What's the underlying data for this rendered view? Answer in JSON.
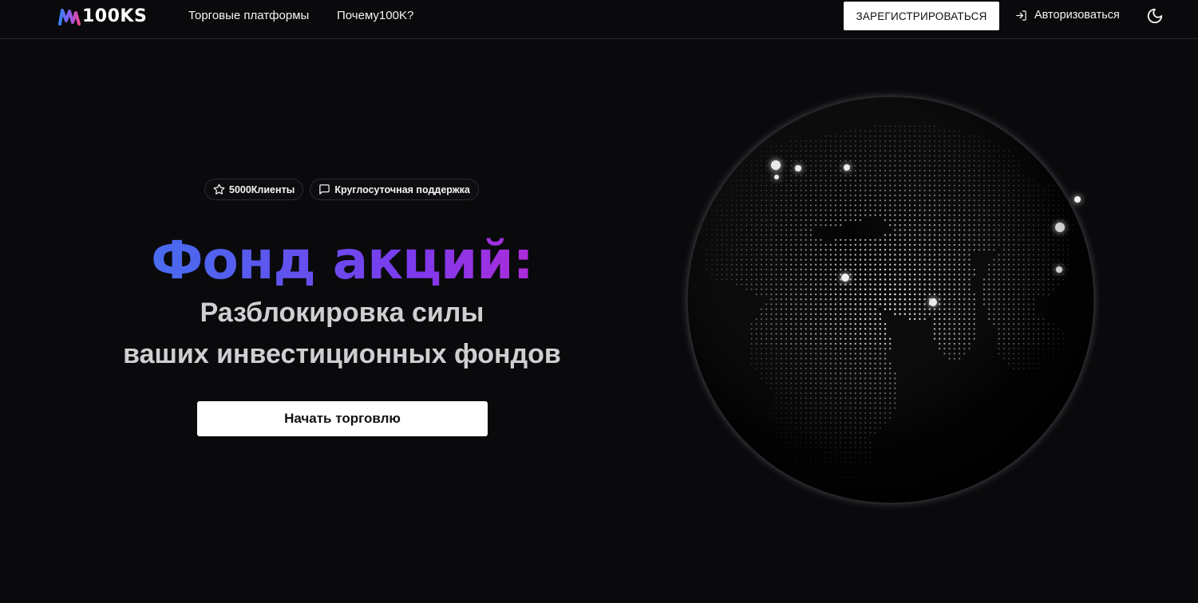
{
  "header": {
    "logo_text": "100KS",
    "nav": [
      {
        "label": "Торговые платформы"
      },
      {
        "label": "Почему100K?"
      }
    ],
    "register_label": "ЗАРЕГИСТРИРОВАТЬСЯ",
    "login_label": "Авторизоваться",
    "theme_icon": "moon-icon"
  },
  "hero": {
    "badges": [
      {
        "icon": "star-icon",
        "label": "5000Клиенты"
      },
      {
        "icon": "message-square-icon",
        "label": "Круглосуточная поддержка"
      }
    ],
    "title": "Фонд акций:",
    "subtitle_line1": "Разблокировка силы",
    "subtitle_line2": "ваших инвестиционных фондов",
    "cta_label": "Начать торговлю"
  },
  "colors": {
    "background": "#0a0a0c",
    "title_gradient_start": "#3b82f6",
    "title_gradient_mid": "#7c3aed",
    "title_gradient_end": "#ec4899",
    "button_bg": "#ffffff"
  },
  "illustration": "globe-dotted-map-icon"
}
